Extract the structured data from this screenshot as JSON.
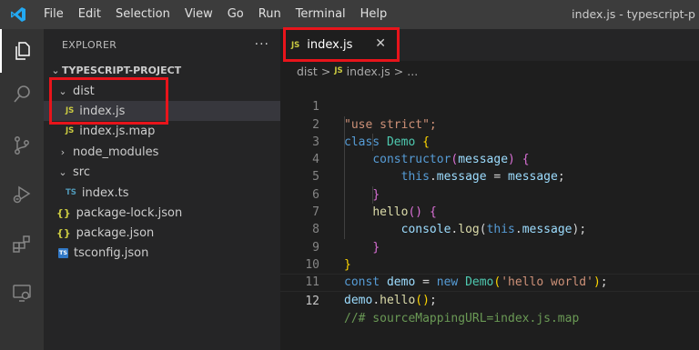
{
  "titlebar": {
    "logo": "vscode-logo-icon",
    "menu": [
      "File",
      "Edit",
      "Selection",
      "View",
      "Go",
      "Run",
      "Terminal",
      "Help"
    ],
    "window_title": "index.js - typescript-p"
  },
  "activity_bar": {
    "icons": [
      "explorer-icon",
      "search-icon",
      "source-control-icon",
      "run-debug-icon",
      "extensions-icon",
      "remote-explorer-icon"
    ]
  },
  "sidebar": {
    "title": "EXPLORER",
    "more": "···",
    "root": "TYPESCRIPT-PROJECT",
    "dist_folder": "dist",
    "dist_files": [
      "index.js",
      "index.js.map"
    ],
    "node_modules": "node_modules",
    "src_folder": "src",
    "src_files": [
      "index.ts"
    ],
    "root_files": [
      "package-lock.json",
      "package.json",
      "tsconfig.json"
    ],
    "js_badge": "JS",
    "ts_badge": "TS",
    "json_badge": "{}"
  },
  "editor": {
    "tab_label": "index.js",
    "tab_close": "✕",
    "breadcrumb": {
      "folder": "dist",
      "separator": ">",
      "file": "index.js",
      "ellipsis": "..."
    },
    "line_numbers": [
      "1",
      "2",
      "3",
      "4",
      "5",
      "6",
      "7",
      "8",
      "9",
      "10",
      "11",
      "12"
    ],
    "current_line": "12",
    "code_lines": [
      "\"use strict\";",
      "class Demo {",
      "    constructor(message) {",
      "        this.message = message;",
      "    }",
      "    hello() {",
      "        console.log(this.message);",
      "    }",
      "}",
      "const demo = new Demo('hello world');",
      "demo.hello();",
      "//# sourceMappingURL=index.js.map"
    ]
  },
  "colors": {
    "highlight": "#e8141b",
    "keyword": "#569cd6",
    "string": "#ce9178",
    "type": "#4ec9b0",
    "function": "#dcdcaa",
    "variable": "#9cdcfe",
    "comment": "#6a9955"
  }
}
